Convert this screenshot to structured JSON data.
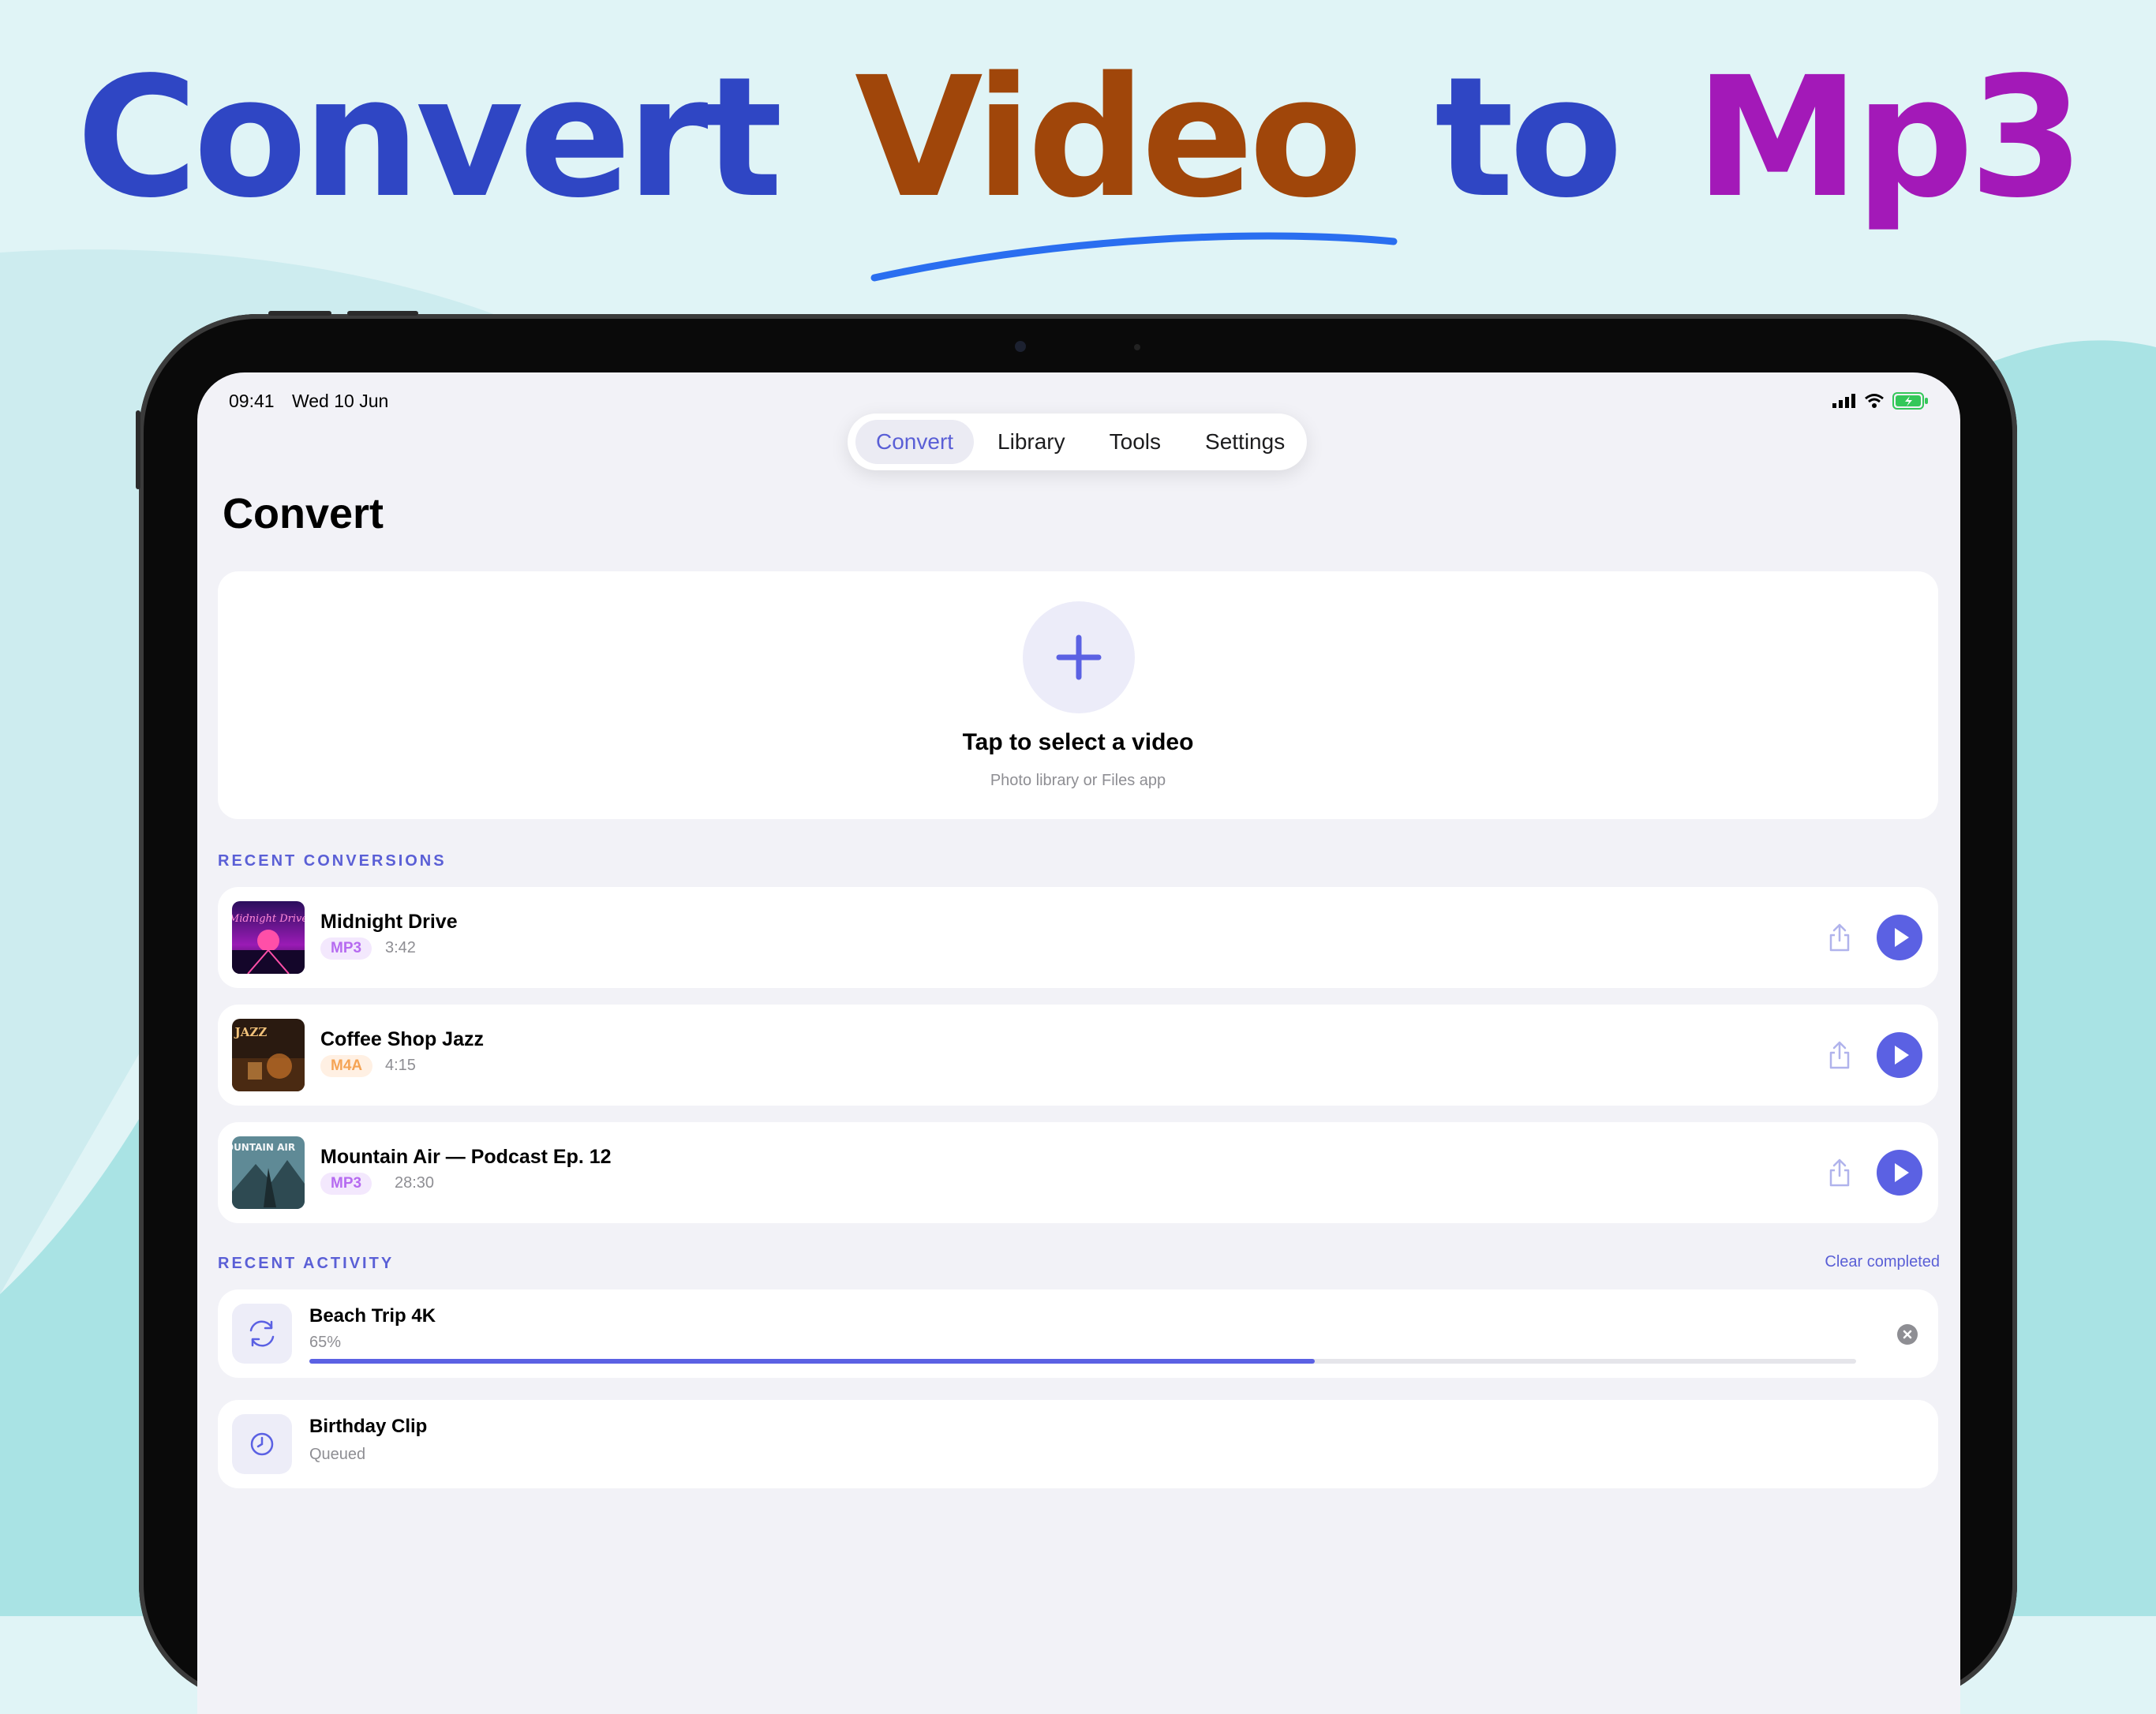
{
  "headline": {
    "word1": "Convert",
    "word2": "Video",
    "word3": "to",
    "word4": "Mp3",
    "color1": "#2f46c4",
    "color2": "#a0460a",
    "color3": "#2f46c4",
    "color4": "#a319b8"
  },
  "status_bar": {
    "time": "09:41",
    "date": "Wed 10 Jun"
  },
  "tabs": [
    {
      "label": "Convert",
      "active": true
    },
    {
      "label": "Library",
      "active": false
    },
    {
      "label": "Tools",
      "active": false
    },
    {
      "label": "Settings",
      "active": false
    }
  ],
  "page_title": "Convert",
  "picker": {
    "title": "Tap to select a video",
    "subtitle": "Photo library or Files app"
  },
  "recent_conversions": {
    "label": "RECENT CONVERSIONS",
    "items": [
      {
        "title": "Midnight Drive",
        "format": "MP3",
        "duration": "3:42",
        "art_text": "Midnight Drive"
      },
      {
        "title": "Coffee Shop Jazz",
        "format": "M4A",
        "duration": "4:15",
        "art_text": "JAZZ"
      },
      {
        "title": "Mountain Air — Podcast Ep. 12",
        "format": "MP3",
        "duration": "28:30",
        "art_text": "MOUNTAIN AIR"
      }
    ]
  },
  "recent_activity": {
    "label": "RECENT ACTIVITY",
    "clear_label": "Clear completed",
    "items": [
      {
        "title": "Beach Trip 4K",
        "status": "65%",
        "progress": 0.65
      },
      {
        "title": "Birthday Clip",
        "status": "Queued"
      }
    ]
  },
  "colors": {
    "accent": "#5b61e3",
    "background": "#f2f2f7"
  }
}
